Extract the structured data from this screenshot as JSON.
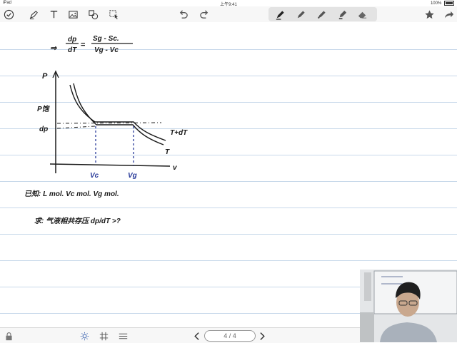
{
  "status_bar": {
    "carrier": "iPad",
    "time": "上午9:41",
    "battery": "100%"
  },
  "toolbar": {
    "left_icons": [
      "checkmark-circle-icon",
      "pen-icon",
      "text-icon",
      "image-icon",
      "shapes-icon",
      "lasso-select-icon"
    ],
    "history_icons": [
      "undo-icon",
      "redo-icon"
    ],
    "pen_tools": [
      "fountain-pen-icon",
      "ballpoint-pen-icon",
      "brush-pen-icon",
      "highlighter-icon",
      "eraser-icon"
    ],
    "right_icons": [
      "star-icon",
      "share-icon"
    ]
  },
  "notes": {
    "equation_numerator": "dp",
    "equation_denominator": "dT",
    "rhs_numerator": "Sg - Sc.",
    "rhs_denominator": "Vg - Vc",
    "axis_y": "P",
    "axis_x": "v",
    "p_sat": "P饱",
    "dp": "dp",
    "curve_t_dt": "T+dT",
    "curve_t": "T",
    "v_l": "Vc",
    "v_g": "Vg",
    "known": "已知: L mol.  Vc mol.  Vg mol.",
    "question": "求: 气液相共存压  dp/dT >?"
  },
  "bottom_bar": {
    "page_indicator": "4 / 4",
    "icons": [
      "lock-icon",
      "brightness-icon",
      "grid-icon",
      "list-icon",
      "prev-page-icon",
      "next-page-icon"
    ]
  },
  "colors": {
    "ink": "#1a1a1a",
    "blue_ink": "#2a3b9a",
    "ruled_line": "#c7d8ea",
    "toolbar_bg": "#f7f7f7"
  }
}
